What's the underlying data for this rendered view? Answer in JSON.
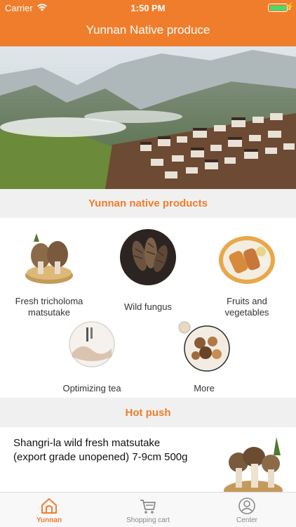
{
  "status_bar": {
    "carrier": "Carrier",
    "time": "1:50 PM"
  },
  "header": {
    "title": "Yunnan Native produce"
  },
  "hero": {
    "icon": "mountain-village-photo"
  },
  "products_section": {
    "title": "Yunnan native products",
    "categories": [
      {
        "label": "Fresh tricholoma matsutake",
        "icon": "matsutake-photo"
      },
      {
        "label": "Wild fungus",
        "icon": "morel-photo"
      },
      {
        "label": "Fruits and vegetables",
        "icon": "vegetables-photo"
      },
      {
        "label": "Optimizing tea",
        "icon": "tea-photo"
      },
      {
        "label": "More",
        "icon": "dried-mushrooms-photo"
      }
    ]
  },
  "hot_push": {
    "title": "Hot push",
    "items": [
      {
        "name": "Shangri-la wild fresh matsutake (export grade unopened) 7-9cm 500g",
        "icon": "matsutake-basket-photo"
      }
    ]
  },
  "tab_bar": {
    "tabs": [
      {
        "label": "Yunnan",
        "icon": "home-icon",
        "active": true
      },
      {
        "label": "Shopping cart",
        "icon": "cart-icon",
        "active": false
      },
      {
        "label": "Center",
        "icon": "user-icon",
        "active": false
      }
    ]
  },
  "colors": {
    "accent": "#f07d2c",
    "battery": "#4cd964"
  }
}
